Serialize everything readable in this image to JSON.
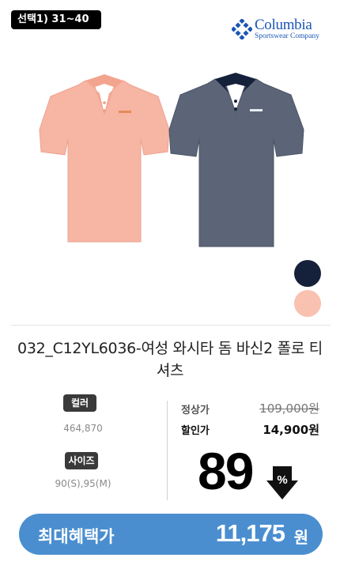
{
  "badge": {
    "label": "선택1) 31~40"
  },
  "brand": {
    "name": "Columbia",
    "sub": "Sportswear Company",
    "color": "#1a56b5"
  },
  "product": {
    "title": "032_C12YL6036-여성 와시타 돔 바신2 폴로 티셔츠",
    "swatches": [
      {
        "name": "navy",
        "color": "#15203a"
      },
      {
        "name": "pink",
        "color": "#f9c1b0"
      }
    ]
  },
  "options": {
    "color_label": "컬러",
    "color_value": "464,870",
    "size_label": "사이즈",
    "size_value": "90(S),95(M)"
  },
  "price": {
    "regular_label": "정상가",
    "regular_value": "109,000원",
    "sale_label": "할인가",
    "sale_value": "14,900원",
    "discount": "89",
    "discount_symbol": "%"
  },
  "cta": {
    "label": "최대혜택가",
    "value": "11,175",
    "unit": "원",
    "color": "#4a8ed0"
  }
}
